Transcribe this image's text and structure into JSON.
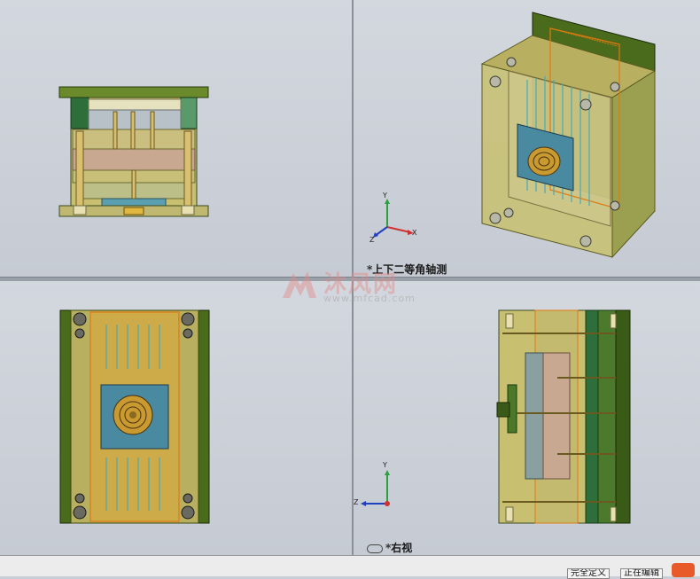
{
  "toolbar": {
    "items": [
      {
        "icon": "zoom-to-fit-icon"
      },
      {
        "icon": "zoom-to-area-icon"
      },
      {
        "icon": "previous-view-icon"
      },
      {
        "icon": "section-view-icon"
      },
      {
        "icon": "view-orientation-icon",
        "dropdown": true
      },
      {
        "icon": "display-style-icon",
        "dropdown": true
      },
      {
        "icon": "hide-show-items-icon",
        "dropdown": true
      },
      {
        "icon": "edit-appearance-icon"
      },
      {
        "icon": "apply-scene-icon",
        "dropdown": true
      },
      {
        "icon": "view-settings-icon",
        "dropdown": true
      }
    ]
  },
  "viewports": {
    "top_right": {
      "label": "*上下二等角轴测"
    },
    "bottom_right": {
      "label": "*右视"
    }
  },
  "triad": {
    "x": "X",
    "y": "Y",
    "z": "Z"
  },
  "watermark": {
    "text": "沐风网",
    "url": "www.mfcad.com"
  },
  "statusbar": {
    "field1": "完全定义",
    "field2": "正在编辑"
  },
  "colors": {
    "mold_green": "#4b6b1c",
    "plate_yellow": "#c8c070",
    "orange_outline": "#e07a10",
    "cyan_lines": "#4aa8b8"
  }
}
